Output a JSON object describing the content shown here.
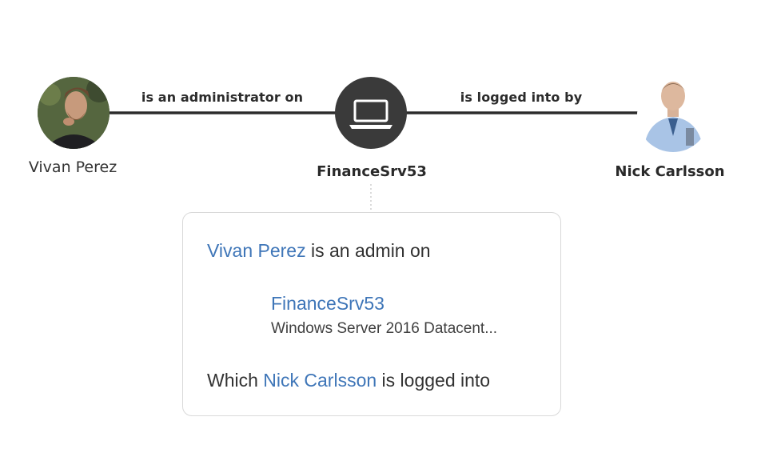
{
  "graph": {
    "nodes": [
      {
        "id": "vivan",
        "label": "Vivan Perez",
        "type": "user",
        "icon": "user-photo-avatar"
      },
      {
        "id": "financesrv",
        "label": "FinanceSrv53",
        "type": "computer",
        "icon": "laptop-icon"
      },
      {
        "id": "nick",
        "label": "Nick Carlsson",
        "type": "user",
        "icon": "user-photo-avatar"
      }
    ],
    "edges": [
      {
        "from": "vivan",
        "to": "financesrv",
        "label": "is an administrator on"
      },
      {
        "from": "financesrv",
        "to": "nick",
        "label": "is logged into by"
      }
    ]
  },
  "card": {
    "line1_user": "Vivan Perez",
    "line1_rest": " is an admin on",
    "server_name": "FinanceSrv53",
    "server_os": "Windows Server 2016 Datacent...",
    "line3_prefix": "Which ",
    "line3_user": "Nick Carlsson",
    "line3_rest": " is logged into"
  },
  "colors": {
    "link": "#3f76b8",
    "node_dark": "#3a3a3a",
    "status_dot": "#c0282d",
    "edge": "#2b2b2b"
  }
}
